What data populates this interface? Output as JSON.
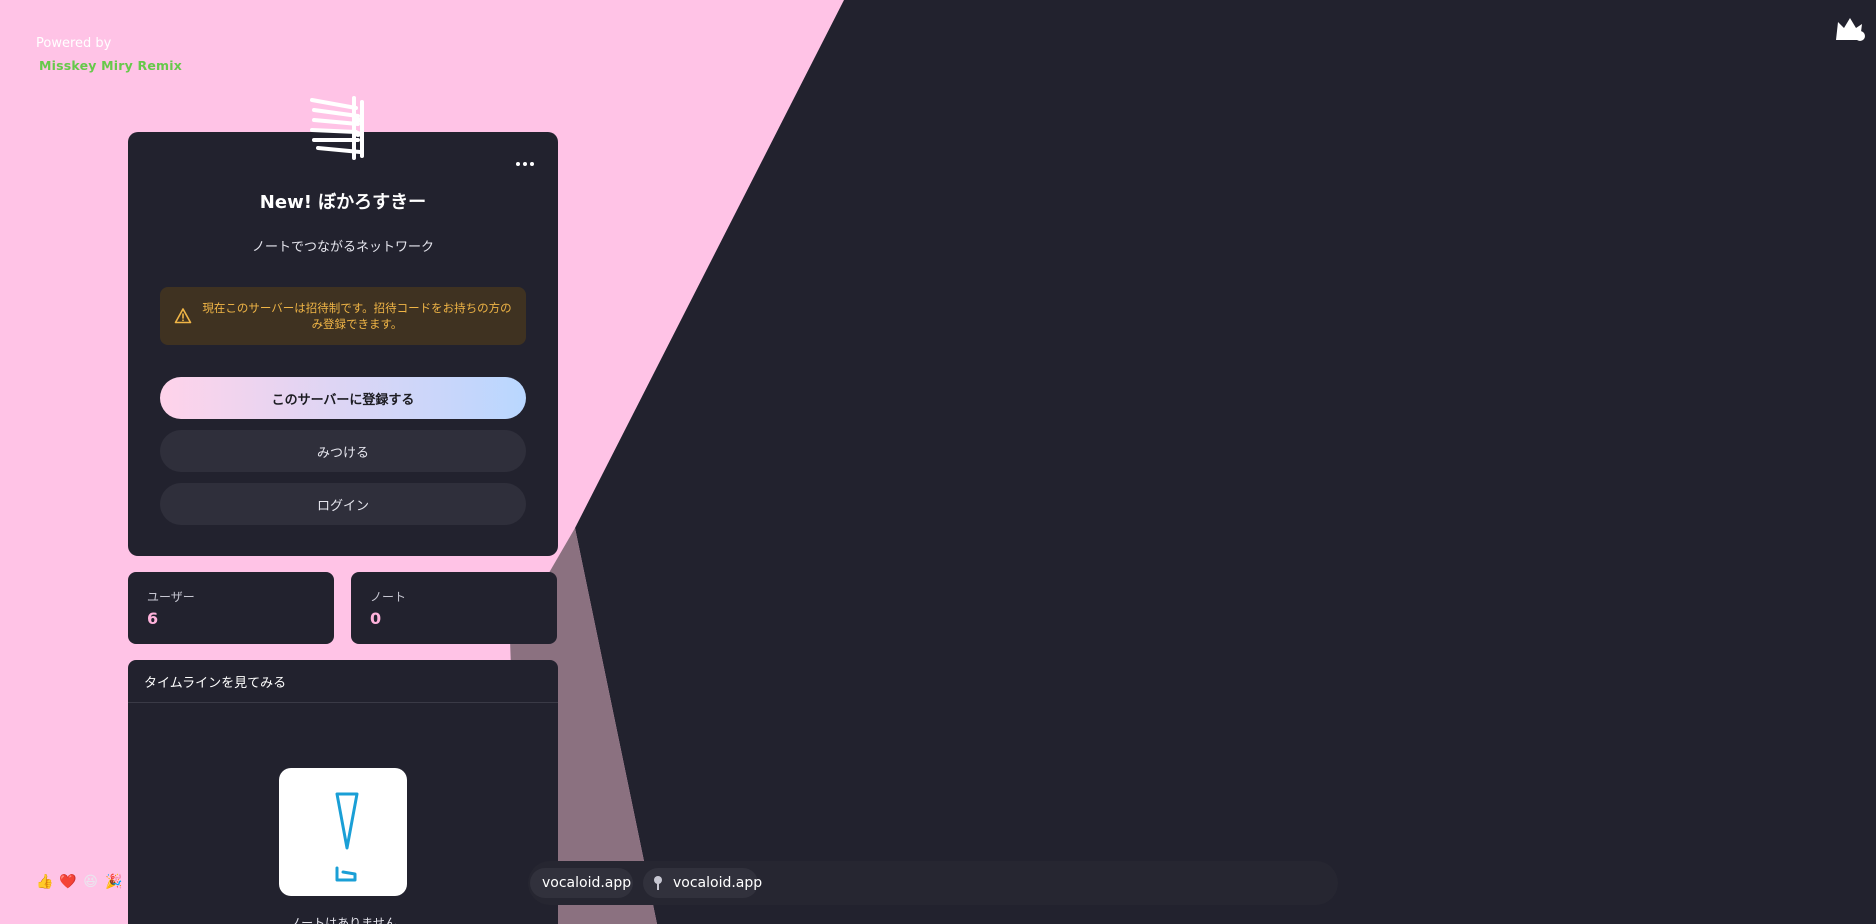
{
  "powered": {
    "label": "Powered by",
    "logo_text": "Misskey Miry Remix"
  },
  "card": {
    "title": "New! ぼかろすきー",
    "description": "ノートでつながるネットワーク",
    "warning": "現在このサーバーは招待制です。招待コードをお持ちの方のみ登録できます。",
    "buttons": {
      "signup": "このサーバーに登録する",
      "explore": "みつける",
      "login": "ログイン"
    }
  },
  "stats": {
    "users_label": "ユーザー",
    "users_value": "6",
    "notes_label": "ノート",
    "notes_value": "0"
  },
  "timeline": {
    "header": "タイムラインを見てみる",
    "empty_text": "ノートはありません"
  },
  "emoji_reactions": [
    "👍",
    "❤️",
    "😆",
    "🎉"
  ],
  "ticker": {
    "items": [
      "vocaloid.app",
      "vocaloid.app"
    ]
  },
  "colors": {
    "background_pink": "#ffc3e6",
    "background_dark": "#22222e",
    "accent_pink": "#ffb2db",
    "warning_text": "#f0b546",
    "logo_green": "#66c94a"
  },
  "icons": {
    "more": "more-dots-icon",
    "warning": "warning-triangle-icon",
    "top_right": "misskey-cat-icon",
    "card": "server-icon",
    "ticker_item": "instance-icon"
  }
}
